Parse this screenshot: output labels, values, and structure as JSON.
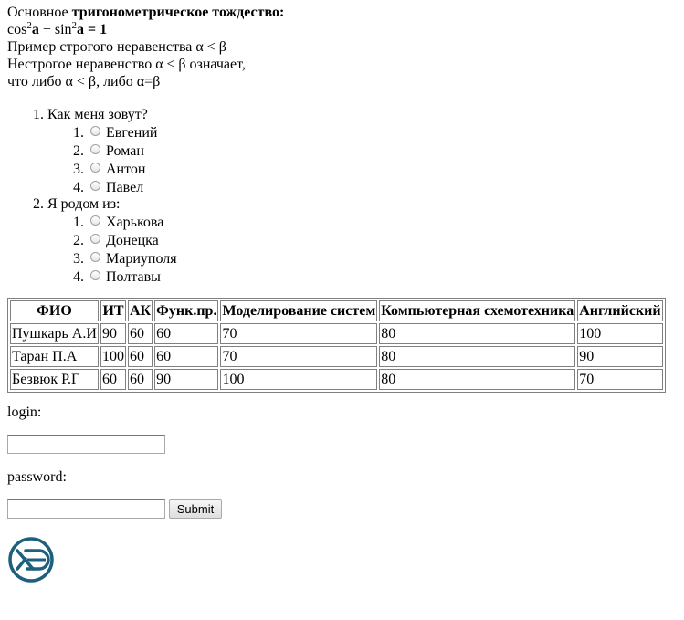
{
  "intro": {
    "line1_prefix": "Основное ",
    "line1_bold": "тригонометрическое тождество:",
    "formula": {
      "cos": "cos",
      "sup1": "2",
      "a1": "a",
      "plus": " + sin",
      "sup2": "2",
      "a2": "a",
      "eq": " = 1"
    },
    "line3": "Пример строгого неравенства α < β",
    "line4": "Нестрогое неравенство α ≤ β означает,",
    "line5": "что либо α < β, либо α=β"
  },
  "quiz": [
    {
      "num": "1.",
      "question": "Как меня зовут?",
      "options": [
        {
          "num": "1.",
          "label": "Евгений"
        },
        {
          "num": "2.",
          "label": "Роман"
        },
        {
          "num": "3.",
          "label": "Антон"
        },
        {
          "num": "4.",
          "label": "Павел"
        }
      ]
    },
    {
      "num": "2.",
      "question": "Я родом из:",
      "options": [
        {
          "num": "1.",
          "label": "Харькова"
        },
        {
          "num": "2.",
          "label": "Донецка"
        },
        {
          "num": "3.",
          "label": "Мариуполя"
        },
        {
          "num": "4.",
          "label": "Полтавы"
        }
      ]
    }
  ],
  "table": {
    "headers": [
      "ФИО",
      "ИТ",
      "АК",
      "Функ.пр.",
      "Моделирование систем",
      "Компьютерная схемотехника",
      "Английский"
    ],
    "rows": [
      [
        "Пушкарь А.И",
        "90",
        "60",
        "60",
        "70",
        "80",
        "100"
      ],
      [
        "Таран П.А",
        "100",
        "60",
        "60",
        "70",
        "80",
        "90"
      ],
      [
        "Безвюк Р.Г",
        "60",
        "60",
        "90",
        "100",
        "80",
        "70"
      ]
    ]
  },
  "form": {
    "login_label": "login:",
    "login_value": "",
    "password_label": "password:",
    "password_value": "",
    "submit_label": "Submit"
  },
  "colors": {
    "logo": "#1d5f7e"
  },
  "logo_icon": "xd-logo-icon"
}
